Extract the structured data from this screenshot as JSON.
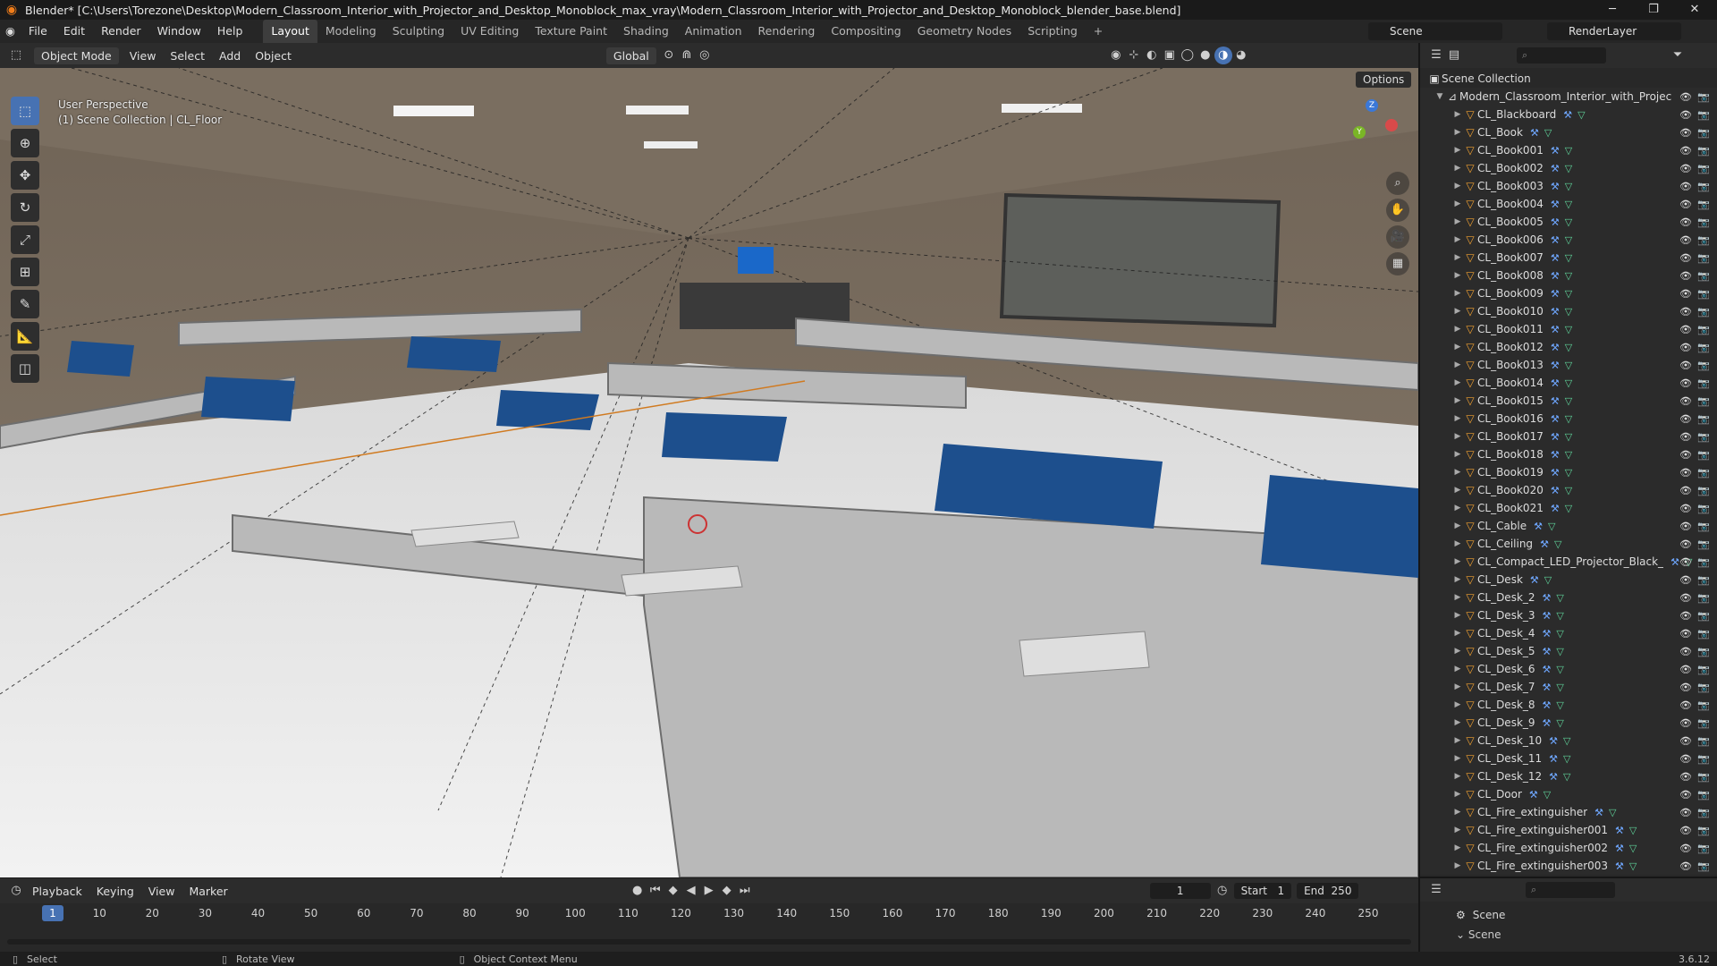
{
  "window": {
    "title": "Blender* [C:\\Users\\Torezone\\Desktop\\Modern_Classroom_Interior_with_Projector_and_Desktop_Monoblock_max_vray\\Modern_Classroom_Interior_with_Projector_and_Desktop_Monoblock_blender_base.blend]"
  },
  "menus": [
    "File",
    "Edit",
    "Render",
    "Window",
    "Help"
  ],
  "workspaces": [
    "Layout",
    "Modeling",
    "Sculpting",
    "UV Editing",
    "Texture Paint",
    "Shading",
    "Animation",
    "Rendering",
    "Compositing",
    "Geometry Nodes",
    "Scripting"
  ],
  "active_workspace": "Layout",
  "scene": {
    "name": "Scene",
    "render_layer": "RenderLayer"
  },
  "viewport_header": {
    "mode": "Object Mode",
    "menus": [
      "View",
      "Select",
      "Add",
      "Object"
    ],
    "orientation": "Global",
    "options_label": "Options"
  },
  "viewport": {
    "perspective": "User Perspective",
    "collection_info": "(1) Scene Collection | CL_Floor"
  },
  "outliner": {
    "root": "Scene Collection",
    "collection": "Modern_Classroom_Interior_with_Projec",
    "items": [
      "CL_Blackboard",
      "CL_Book",
      "CL_Book001",
      "CL_Book002",
      "CL_Book003",
      "CL_Book004",
      "CL_Book005",
      "CL_Book006",
      "CL_Book007",
      "CL_Book008",
      "CL_Book009",
      "CL_Book010",
      "CL_Book011",
      "CL_Book012",
      "CL_Book013",
      "CL_Book014",
      "CL_Book015",
      "CL_Book016",
      "CL_Book017",
      "CL_Book018",
      "CL_Book019",
      "CL_Book020",
      "CL_Book021",
      "CL_Cable",
      "CL_Ceiling",
      "CL_Compact_LED_Projector_Black_",
      "CL_Desk",
      "CL_Desk_2",
      "CL_Desk_3",
      "CL_Desk_4",
      "CL_Desk_5",
      "CL_Desk_6",
      "CL_Desk_7",
      "CL_Desk_8",
      "CL_Desk_9",
      "CL_Desk_10",
      "CL_Desk_11",
      "CL_Desk_12",
      "CL_Door",
      "CL_Fire_extinguisher",
      "CL_Fire_extinguisher001",
      "CL_Fire_extinguisher002",
      "CL_Fire_extinguisher003"
    ]
  },
  "timeline": {
    "menus": [
      "Playback",
      "Keying",
      "View",
      "Marker"
    ],
    "current_frame": "1",
    "start_label": "Start",
    "start": "1",
    "end_label": "End",
    "end": "250",
    "ticks": [
      "1",
      "10",
      "20",
      "30",
      "40",
      "50",
      "60",
      "70",
      "80",
      "90",
      "100",
      "110",
      "120",
      "130",
      "140",
      "150",
      "160",
      "170",
      "180",
      "190",
      "200",
      "210",
      "220",
      "230",
      "240",
      "250"
    ]
  },
  "properties": {
    "scene_label": "Scene",
    "section": "Scene"
  },
  "statusbar": {
    "select": "Select",
    "rotate": "Rotate View",
    "context": "Object Context Menu",
    "version": "3.6.12"
  }
}
